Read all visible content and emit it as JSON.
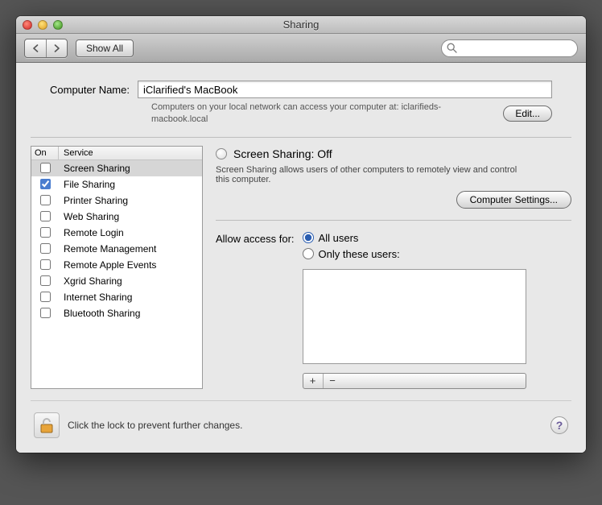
{
  "window": {
    "title": "Sharing"
  },
  "toolbar": {
    "showAll": "Show All",
    "searchPlaceholder": ""
  },
  "computerName": {
    "label": "Computer Name:",
    "value": "iClarified's MacBook",
    "subtext": "Computers on your local network can access your computer at: iclarifieds-macbook.local",
    "editBtn": "Edit..."
  },
  "services": {
    "headers": {
      "on": "On",
      "service": "Service"
    },
    "items": [
      {
        "label": "Screen Sharing",
        "checked": false,
        "selected": true
      },
      {
        "label": "File Sharing",
        "checked": true,
        "selected": false
      },
      {
        "label": "Printer Sharing",
        "checked": false,
        "selected": false
      },
      {
        "label": "Web Sharing",
        "checked": false,
        "selected": false
      },
      {
        "label": "Remote Login",
        "checked": false,
        "selected": false
      },
      {
        "label": "Remote Management",
        "checked": false,
        "selected": false
      },
      {
        "label": "Remote Apple Events",
        "checked": false,
        "selected": false
      },
      {
        "label": "Xgrid Sharing",
        "checked": false,
        "selected": false
      },
      {
        "label": "Internet Sharing",
        "checked": false,
        "selected": false
      },
      {
        "label": "Bluetooth Sharing",
        "checked": false,
        "selected": false
      }
    ]
  },
  "detail": {
    "statusTitle": "Screen Sharing: Off",
    "statusDesc": "Screen Sharing allows users of other computers to remotely view and control this computer.",
    "computerSettingsBtn": "Computer Settings...",
    "accessLabel": "Allow access for:",
    "radioAll": "All users",
    "radioOnly": "Only these users:",
    "selectedRadio": "all",
    "plus": "+",
    "minus": "−"
  },
  "footer": {
    "lockText": "Click the lock to prevent further changes.",
    "help": "?"
  }
}
